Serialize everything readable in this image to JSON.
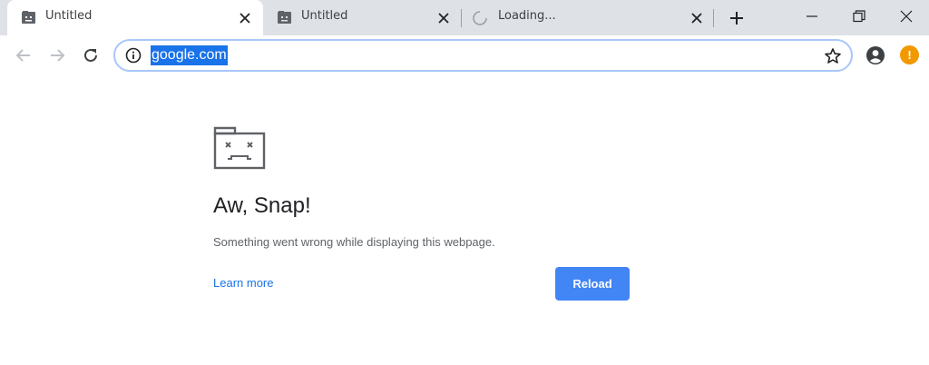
{
  "tabs": [
    {
      "title": "Untitled",
      "state": "active",
      "icon": "sad-page-icon"
    },
    {
      "title": "Untitled",
      "state": "inactive",
      "icon": "sad-page-icon"
    },
    {
      "title": "Loading...",
      "state": "loading",
      "icon": "loading-spinner-icon"
    }
  ],
  "toolbar": {
    "url": "google.com",
    "alert_glyph": "!"
  },
  "page": {
    "title": "Aw, Snap!",
    "message": "Something went wrong while displaying this webpage.",
    "learn_more": "Learn more",
    "reload_label": "Reload"
  },
  "colors": {
    "tabstrip": "#dee1e6",
    "accent": "#1a73e8",
    "button": "#4285f4",
    "alert": "#f29900"
  }
}
